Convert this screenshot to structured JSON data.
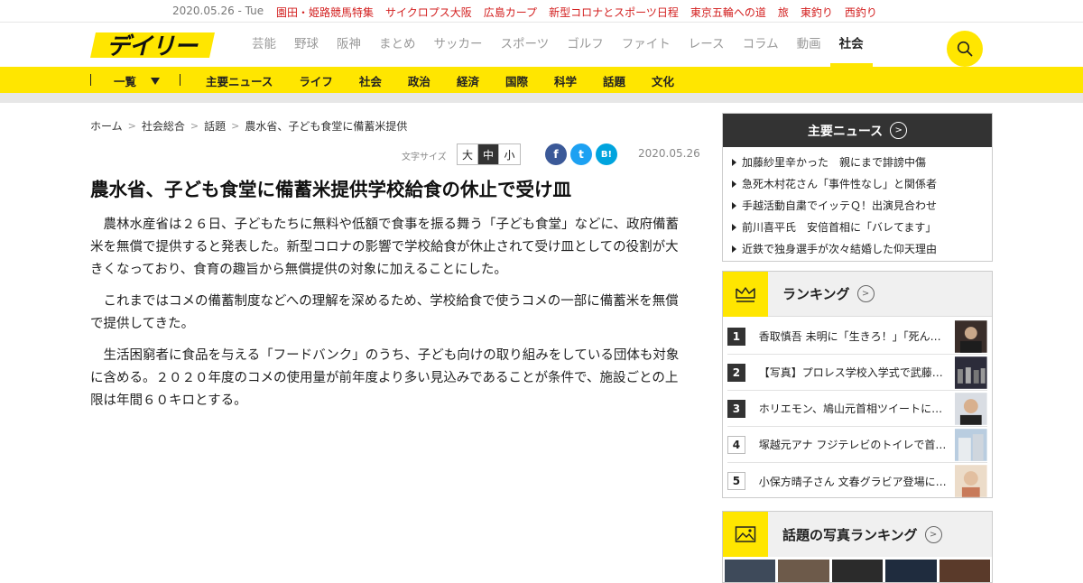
{
  "topbar": {
    "date": "2020.05.26 - Tue",
    "links": [
      "園田・姫路競馬特集",
      "サイクロプス大阪",
      "広島カープ",
      "新型コロナとスポーツ日程",
      "東京五輪への道",
      "旅",
      "東釣り",
      "西釣り"
    ]
  },
  "header": {
    "logo_text": "デイリー",
    "nav": [
      "芸能",
      "野球",
      "阪神",
      "まとめ",
      "サッカー",
      "スポーツ",
      "ゴルフ",
      "ファイト",
      "レース",
      "コラム",
      "動画",
      "社会"
    ],
    "active_nav": "社会"
  },
  "subnav": {
    "list_label": "一覧",
    "items": [
      "主要ニュース",
      "ライフ",
      "社会",
      "政治",
      "経済",
      "国際",
      "科学",
      "話題",
      "文化"
    ]
  },
  "breadcrumb": [
    "ホーム",
    "社会総合",
    "話題",
    "農水省、子ども食堂に備蓄米提供"
  ],
  "article": {
    "font_size_label": "文字サイズ",
    "font_sizes": [
      "大",
      "中",
      "小"
    ],
    "selected_font_size": "中",
    "share": {
      "facebook": "f",
      "twitter": "t",
      "hatena": "B!"
    },
    "date": "2020.05.26",
    "headline": "農水省、子ども食堂に備蓄米提供学校給食の休止で受け皿",
    "paragraphs": [
      "農林水産省は２６日、子どもたちに無料や低額で食事を振る舞う「子ども食堂」などに、政府備蓄米を無償で提供すると発表した。新型コロナの影響で学校給食が休止されて受け皿としての役割が大きくなっており、食育の趣旨から無償提供の対象に加えることにした。",
      "これまではコメの備蓄制度などへの理解を深めるため、学校給食で使うコメの一部に備蓄米を無償で提供してきた。",
      "生活困窮者に食品を与える「フードバンク」のうち、子ども向けの取り組みをしている団体も対象に含める。２０２０年度のコメの使用量が前年度より多い見込みであることが条件で、施設ごとの上限は年間６０キロとする。"
    ]
  },
  "sidebar": {
    "main_news": {
      "title": "主要ニュース",
      "items": [
        "加藤紗里辛かった　親にまで誹謗中傷",
        "急死木村花さん「事件性なし」と関係者",
        "手越活動自粛でイッテＱ！出演見合わせ",
        "前川喜平氏　安倍首相に「バレてます」",
        "近鉄で独身選手が次々結婚した仰天理由"
      ]
    },
    "ranking": {
      "title": "ランキング",
      "items": [
        {
          "rank": "1",
          "text": "香取慎吾 未明に「生きろ！」「死ん…"
        },
        {
          "rank": "2",
          "text": "【写真】プロレス学校入学式で武藤あ…"
        },
        {
          "rank": "3",
          "text": "ホリエモン、鳩山元首相ツイートに猛…"
        },
        {
          "rank": "4",
          "text": "塚越元アナ フジテレビのトイレで首…"
        },
        {
          "rank": "5",
          "text": "小保方晴子さん 文春グラビア登場に…"
        }
      ]
    },
    "photo_ranking": {
      "title": "話題の写真ランキング"
    }
  },
  "colors": {
    "brand_yellow": "#ffe600",
    "link_red": "#d32020",
    "dark": "#333333"
  }
}
